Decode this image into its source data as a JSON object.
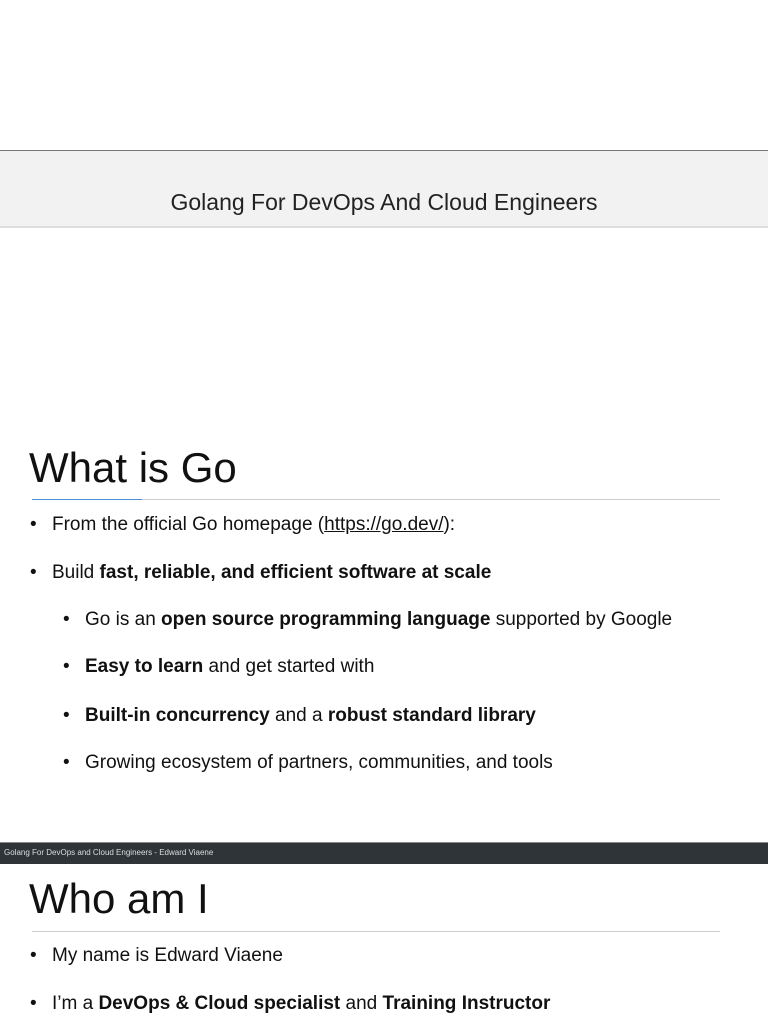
{
  "header": {
    "title": "Golang For DevOps And Cloud Engineers"
  },
  "slide1": {
    "title": "What is Go",
    "bullets": [
      {
        "pre": "From the official Go homepage (",
        "link": "https://go.dev/",
        "post": "):"
      },
      {
        "pre": "Build ",
        "bold": "fast, reliable, and efficient software at scale"
      },
      {
        "pre": "Go is an ",
        "bold": "open source programming language",
        "post": " supported by Google"
      },
      {
        "bold": "Easy to learn",
        "post": " and get started with"
      },
      {
        "bold": "Built-in concurrency",
        "mid": " and a ",
        "bold2": "robust standard library"
      },
      {
        "pre": "Growing ecosystem of partners, communities, and tools"
      }
    ]
  },
  "footer": {
    "text": "Golang For DevOps and Cloud Engineers - Edward Viaene"
  },
  "slide2": {
    "title": "Who am I",
    "bullets": [
      {
        "pre": "My name is Edward Viaene"
      },
      {
        "pre": "I’m a ",
        "bold": "DevOps & Cloud specialist",
        "mid": " and ",
        "bold2": "Training Instructor"
      }
    ]
  }
}
